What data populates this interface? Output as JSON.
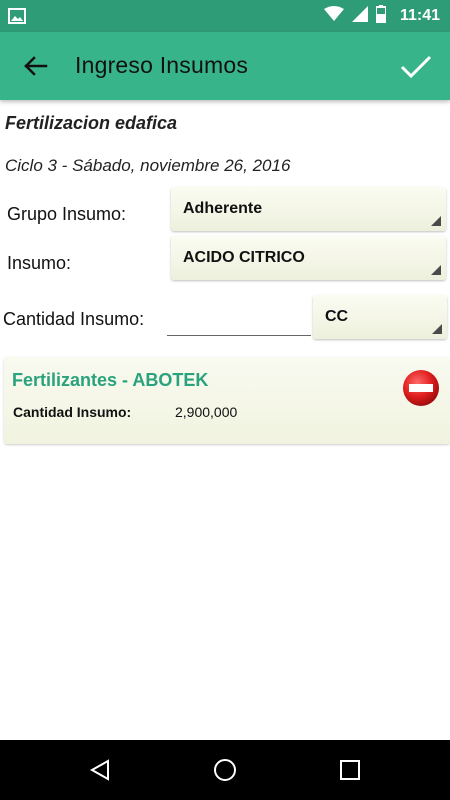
{
  "status_bar": {
    "time": "11:41",
    "icons": [
      "image-icon",
      "wifi-icon",
      "signal-icon",
      "battery-icon"
    ]
  },
  "app_bar": {
    "title": "Ingreso Insumos",
    "back_icon": "arrow-left-icon",
    "confirm_icon": "check-icon"
  },
  "section": {
    "title": "Fertilizacion edafica",
    "cycle": "Ciclo 3 - Sábado, noviembre 26, 2016"
  },
  "form": {
    "grupo_label": "Grupo Insumo:",
    "grupo_value": "Adherente",
    "insumo_label": "Insumo:",
    "insumo_value": "ACIDO CITRICO",
    "cantidad_label": "Cantidad Insumo:",
    "cantidad_value": "",
    "unit_value": "CC"
  },
  "items": [
    {
      "title": "Fertilizantes - ABOTEK",
      "qty_label": "Cantidad Insumo:",
      "qty_value": "2,900,000"
    }
  ],
  "colors": {
    "status_bar": "#2f9c78",
    "app_bar": "#38b48b",
    "accent_text": "#2aa27d",
    "remove_red": "#d91c1c"
  }
}
